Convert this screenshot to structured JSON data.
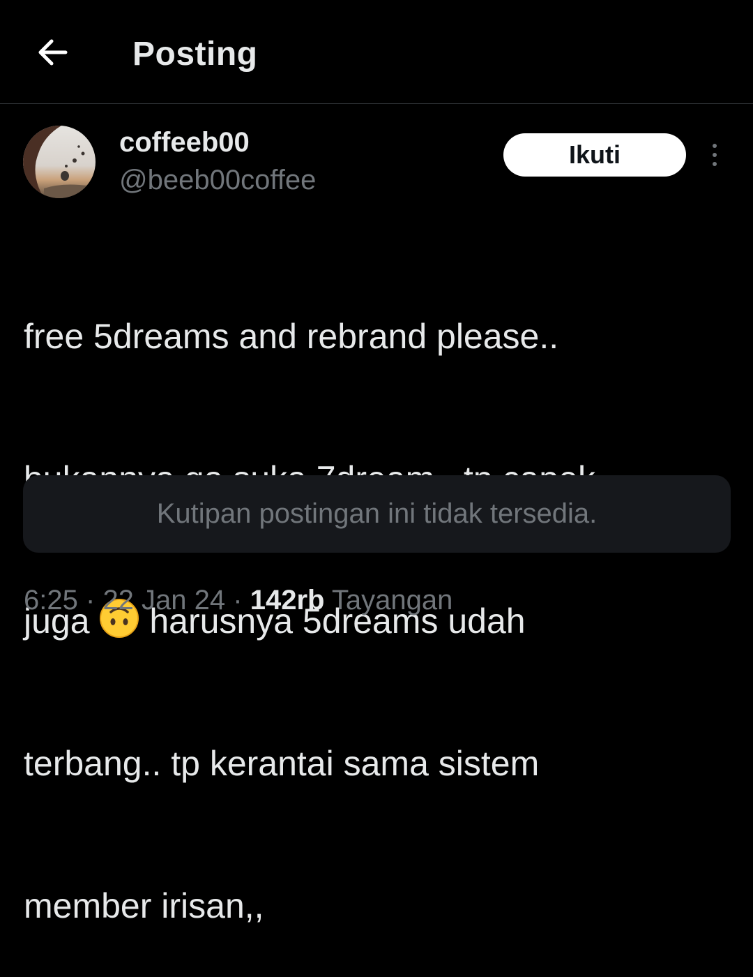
{
  "header": {
    "title": "Posting",
    "back_icon": "arrow-left-icon"
  },
  "author": {
    "display_name": "coffeeb00",
    "handle": "@beeb00coffee"
  },
  "follow_button": {
    "label": "Ikuti"
  },
  "more_icon": "more-vertical-icon",
  "post": {
    "lines": [
      "free 5dreams and rebrand please..",
      "bukannya ga suka 7dream.. tp capek",
      "juga",
      "harusnya 5dreams udah",
      "terbang.. tp kerantai sama sistem",
      "member irisan,,"
    ],
    "emoji": "upside-down-face-emoji"
  },
  "quote": {
    "text": "Kutipan postingan ini tidak tersedia."
  },
  "meta": {
    "time": "6:25",
    "separator": "·",
    "date": "22 Jan 24",
    "views_count": "142rb",
    "views_label": "Tayangan"
  },
  "colors": {
    "background": "#000000",
    "primary_text": "#e7e9ea",
    "secondary_text": "#71767b",
    "quote_bg": "#16181c",
    "divider": "#2f3336",
    "button_bg": "#ffffff"
  }
}
